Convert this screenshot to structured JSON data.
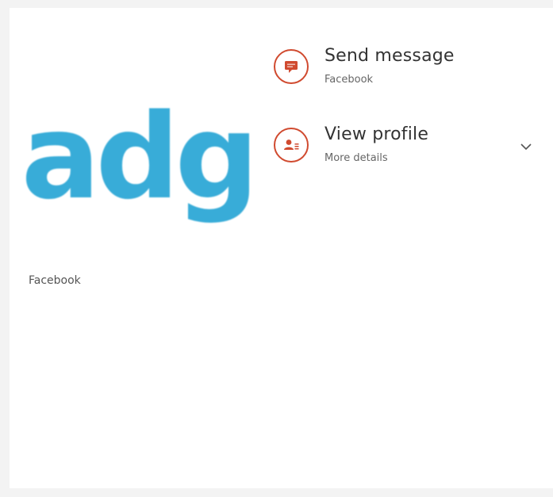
{
  "contact": {
    "logo_text": "adg",
    "logo_caption": "Facebook"
  },
  "actions": [
    {
      "title": "Send message",
      "subtitle": "Facebook",
      "icon": "message-icon"
    },
    {
      "title": "View profile",
      "subtitle": "More details",
      "icon": "profile-icon"
    }
  ],
  "expand_icon": "chevron-down-icon",
  "colors": {
    "accent": "#d04a2f",
    "logo": "#38acd8",
    "background": "#ffffff"
  }
}
